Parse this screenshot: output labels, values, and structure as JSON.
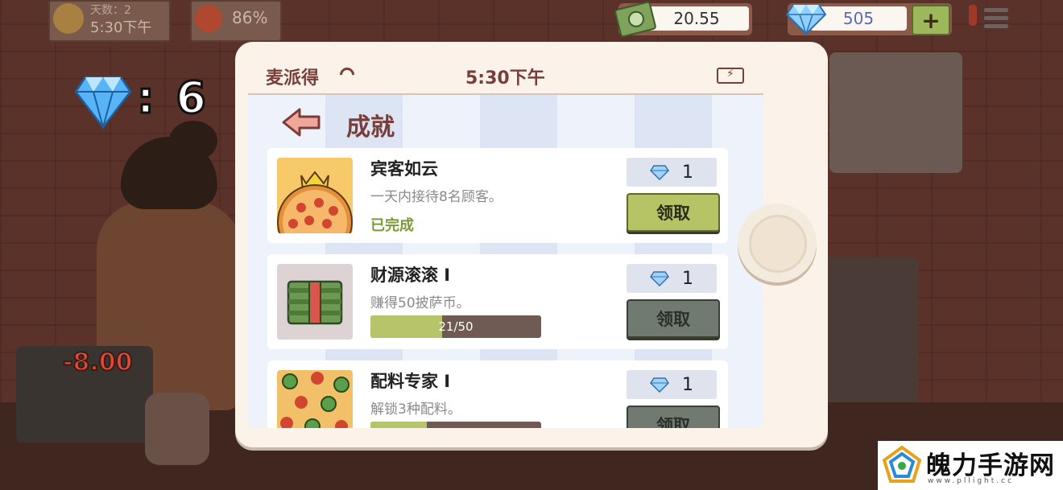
{
  "hud": {
    "day_label": "天数：2",
    "time": "5:30下午",
    "mood": "86%",
    "money": "20.55",
    "gems": "505",
    "plus_label": "+"
  },
  "bonus": {
    "separator": ":",
    "count": "6"
  },
  "floating_text": "-8.00",
  "phone": {
    "carrier": "麦派得",
    "time": "5:30下午",
    "page_title": "成就",
    "achievements": [
      {
        "title": "宾客如云",
        "description": "一天内接待8名顾客。",
        "status": "已完成",
        "reward": "1",
        "claim_label": "领取",
        "claimable": true
      },
      {
        "title": "财源滚滚 I",
        "description": "赚得50披萨币。",
        "progress_text": "21/50",
        "progress": 0.42,
        "reward": "1",
        "claim_label": "领取",
        "claimable": false
      },
      {
        "title": "配料专家 I",
        "description": "解锁3种配料。",
        "progress": 0.33,
        "reward": "1",
        "claim_label": "领取",
        "claimable": false
      }
    ]
  },
  "watermark": {
    "text": "魄力手游网",
    "url": "www.pllight.cc"
  },
  "icons": {
    "diamond": "diamond-icon",
    "cash": "cash-icon",
    "back": "back-arrow-icon",
    "battery": "battery-icon",
    "wifi": "wifi-icon"
  },
  "colors": {
    "accent_green": "#b6c466",
    "title_maroon": "#7a3e3a",
    "diamond_blue": "#4aa3f0"
  }
}
